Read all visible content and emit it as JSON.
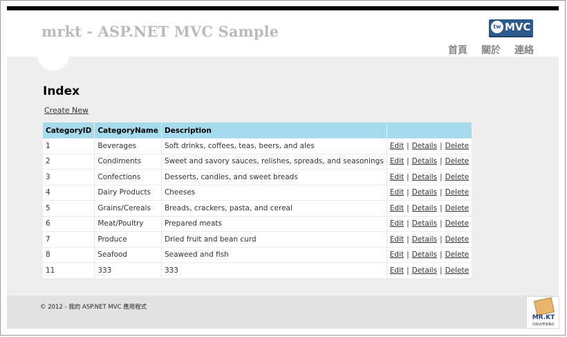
{
  "header": {
    "site_title": "mrkt - ASP.NET MVC Sample",
    "logo_tw": "tw",
    "logo_text": "MVC",
    "nav": [
      "首頁",
      "關於",
      "連絡"
    ]
  },
  "main": {
    "title": "Index",
    "create_link": "Create New",
    "columns": [
      "CategoryID",
      "CategoryName",
      "Description",
      ""
    ],
    "rows": [
      {
        "id": "1",
        "name": "Beverages",
        "description": "Soft drinks, coffees, teas, beers, and ales"
      },
      {
        "id": "2",
        "name": "Condiments",
        "description": "Sweet and savory sauces, relishes, spreads, and seasonings"
      },
      {
        "id": "3",
        "name": "Confections",
        "description": "Desserts, candies, and sweet breads"
      },
      {
        "id": "4",
        "name": "Dairy Products",
        "description": "Cheeses"
      },
      {
        "id": "5",
        "name": "Grains/Cereals",
        "description": "Breads, crackers, pasta, and cereal"
      },
      {
        "id": "6",
        "name": "Meat/Poultry",
        "description": "Prepared meats"
      },
      {
        "id": "7",
        "name": "Produce",
        "description": "Dried fruit and bean curd"
      },
      {
        "id": "8",
        "name": "Seafood",
        "description": "Seaweed and fish"
      },
      {
        "id": "11",
        "name": "333",
        "description": "333"
      }
    ],
    "actions": {
      "edit": "Edit",
      "details": "Details",
      "delete": "Delete",
      "separator": "|"
    }
  },
  "footer": {
    "copyright": "© 2012 - 我的 ASP.NET MVC 應用程式",
    "badge_name": "MR.KT",
    "badge_tagline": "的程式學習筆記"
  },
  "colors": {
    "table_header": "#a6dbed",
    "page_background": "#eeeeee",
    "logo_blue": "#2d5a8e"
  }
}
